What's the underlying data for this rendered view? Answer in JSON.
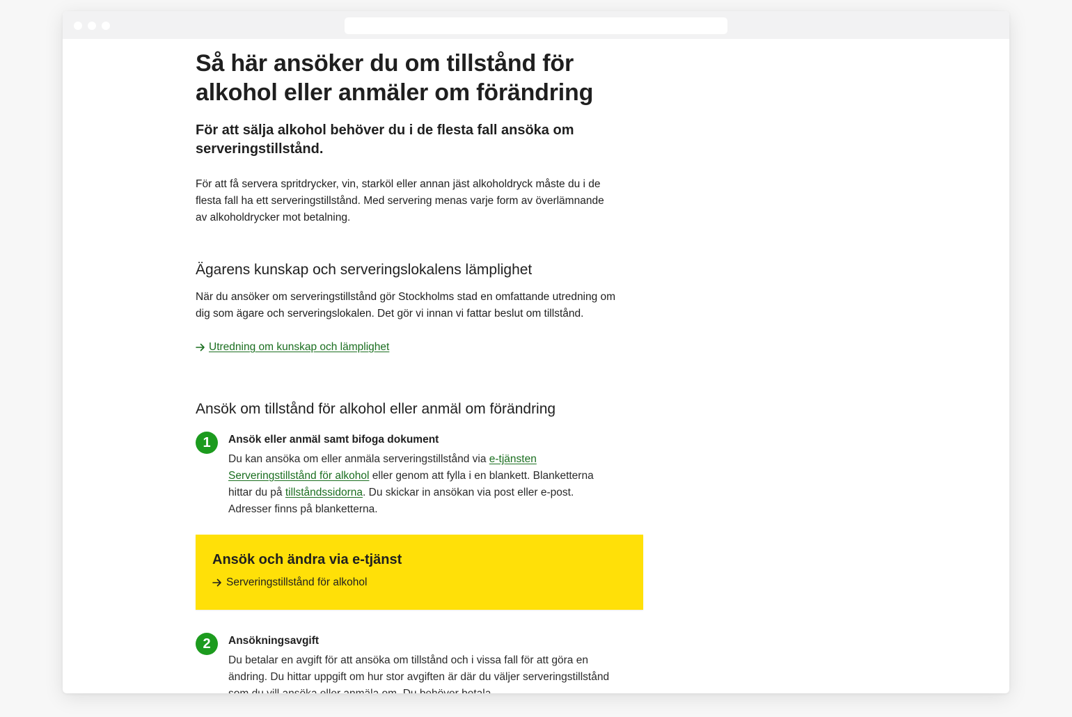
{
  "browser": {
    "url": ""
  },
  "page": {
    "title": "Så här ansöker du om tillstånd för alkohol eller anmäler om förändring",
    "lead": "För att sälja alkohol behöver du i de flesta fall ansöka om serveringstillstånd.",
    "intro": "För att få servera spritdrycker, vin, starköl eller annan jäst alkoholdryck måste du i de flesta fall ha ett serveringstillstånd. Med servering menas varje form av överlämnande av alkoholdrycker mot betalning."
  },
  "section1": {
    "heading": "Ägarens kunskap och serveringslokalens lämplighet",
    "text": "När du ansöker om serveringstillstånd gör Stockholms stad en omfattande utredning om dig som ägare och serveringslokalen. Det gör vi innan vi fattar beslut om tillstånd.",
    "link_label": "Utredning om kunskap och lämplighet"
  },
  "section2": {
    "heading": "Ansök om tillstånd för alkohol eller anmäl om förändring",
    "steps": [
      {
        "number": "1",
        "title": "Ansök eller anmäl samt bifoga dokument",
        "text_1": "Du kan ansöka om eller anmäla serveringstillstånd via ",
        "link_1": "e-tjänsten Serveringstillstånd för alkohol",
        "text_2": " eller genom att fylla i en blankett. Blanketterna hittar du på ",
        "link_2": "tillståndssidorna",
        "text_3": ". Du skickar in ansökan via post eller e-post. Adresser finns på blanketterna."
      },
      {
        "number": "2",
        "title": "Ansökningsavgift",
        "text": "Du betalar en avgift för att ansöka om tillstånd och i vissa fall för att göra en ändring. Du hittar uppgift om hur stor avgiften är där du väljer serveringstillstånd som du vill ansöka eller anmäla om. Du behöver betala"
      }
    ],
    "cta": {
      "title": "Ansök och ändra via e-tjänst",
      "link_label": "Serveringstillstånd för alkohol",
      "background": "#ffe008"
    }
  },
  "colors": {
    "link": "#1a6e1f",
    "step_badge": "#1c9b1e",
    "text": "#1f1f1f"
  },
  "icons": [
    "arrow-right-icon"
  ]
}
